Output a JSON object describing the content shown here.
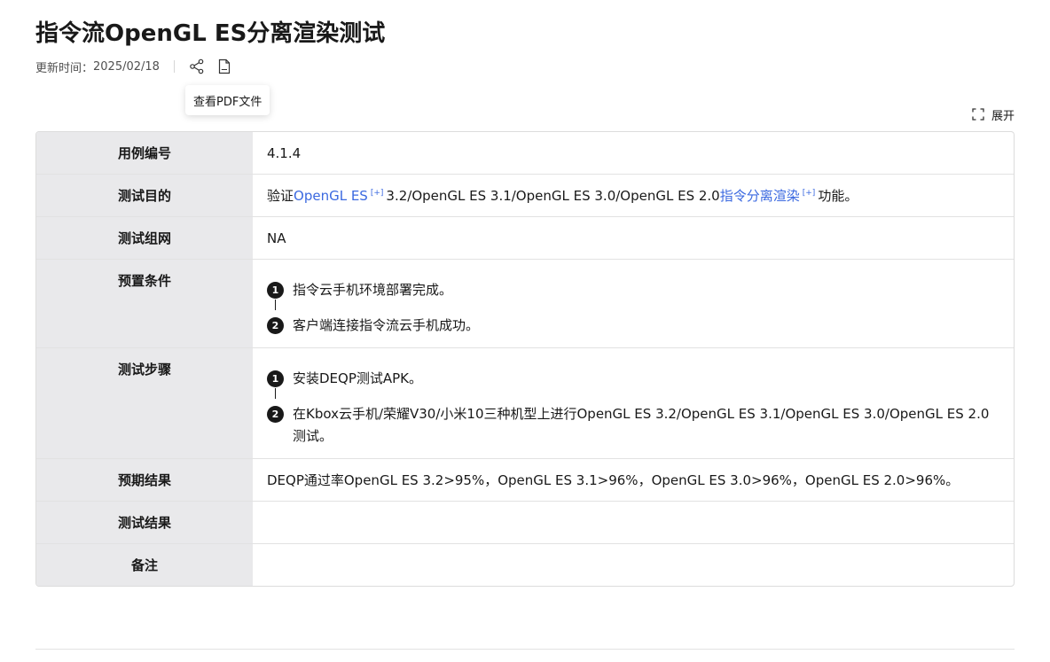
{
  "header": {
    "title": "指令流OpenGL ES分离渲染测试",
    "updated_label": "更新时间：",
    "updated_date": "2025/02/18",
    "share_icon": "share-icon",
    "pdf_icon": "pdf-file-icon",
    "tooltip": "查看PDF文件"
  },
  "toolbar": {
    "expand_label": "展开",
    "expand_icon": "expand-icon"
  },
  "table": {
    "rows": [
      {
        "label": "用例编号",
        "value": "4.1.4"
      },
      {
        "label": "测试目的",
        "value_parts": {
          "prefix": "验证",
          "link1": "OpenGL ES",
          "middle": "3.2/OpenGL ES 3.1/OpenGL ES 3.0/OpenGL ES 2.0",
          "link2": "指令分离渲染",
          "suffix": "功能。",
          "ext_mark": "[+]"
        }
      },
      {
        "label": "测试组网",
        "value": "NA"
      },
      {
        "label": "预置条件",
        "steps": [
          {
            "num": "1",
            "text": "指令云手机环境部署完成。"
          },
          {
            "num": "2",
            "text": "客户端连接指令流云手机成功。"
          }
        ]
      },
      {
        "label": "测试步骤",
        "steps": [
          {
            "num": "1",
            "text": "安装DEQP测试APK。"
          },
          {
            "num": "2",
            "text": "在Kbox云手机/荣耀V30/小米10三种机型上进行OpenGL ES 3.2/OpenGL ES 3.1/OpenGL ES 3.0/OpenGL ES 2.0测试。"
          }
        ]
      },
      {
        "label": "预期结果",
        "value": "DEQP通过率OpenGL ES 3.2>95%，OpenGL ES 3.1>96%，OpenGL ES 3.0>96%，OpenGL ES 2.0>96%。"
      },
      {
        "label": "测试结果",
        "value": ""
      },
      {
        "label": "备注",
        "value": ""
      }
    ]
  },
  "colors": {
    "link": "#3b69e0",
    "label_bg": "#e9e9eb",
    "text": "#191919"
  }
}
